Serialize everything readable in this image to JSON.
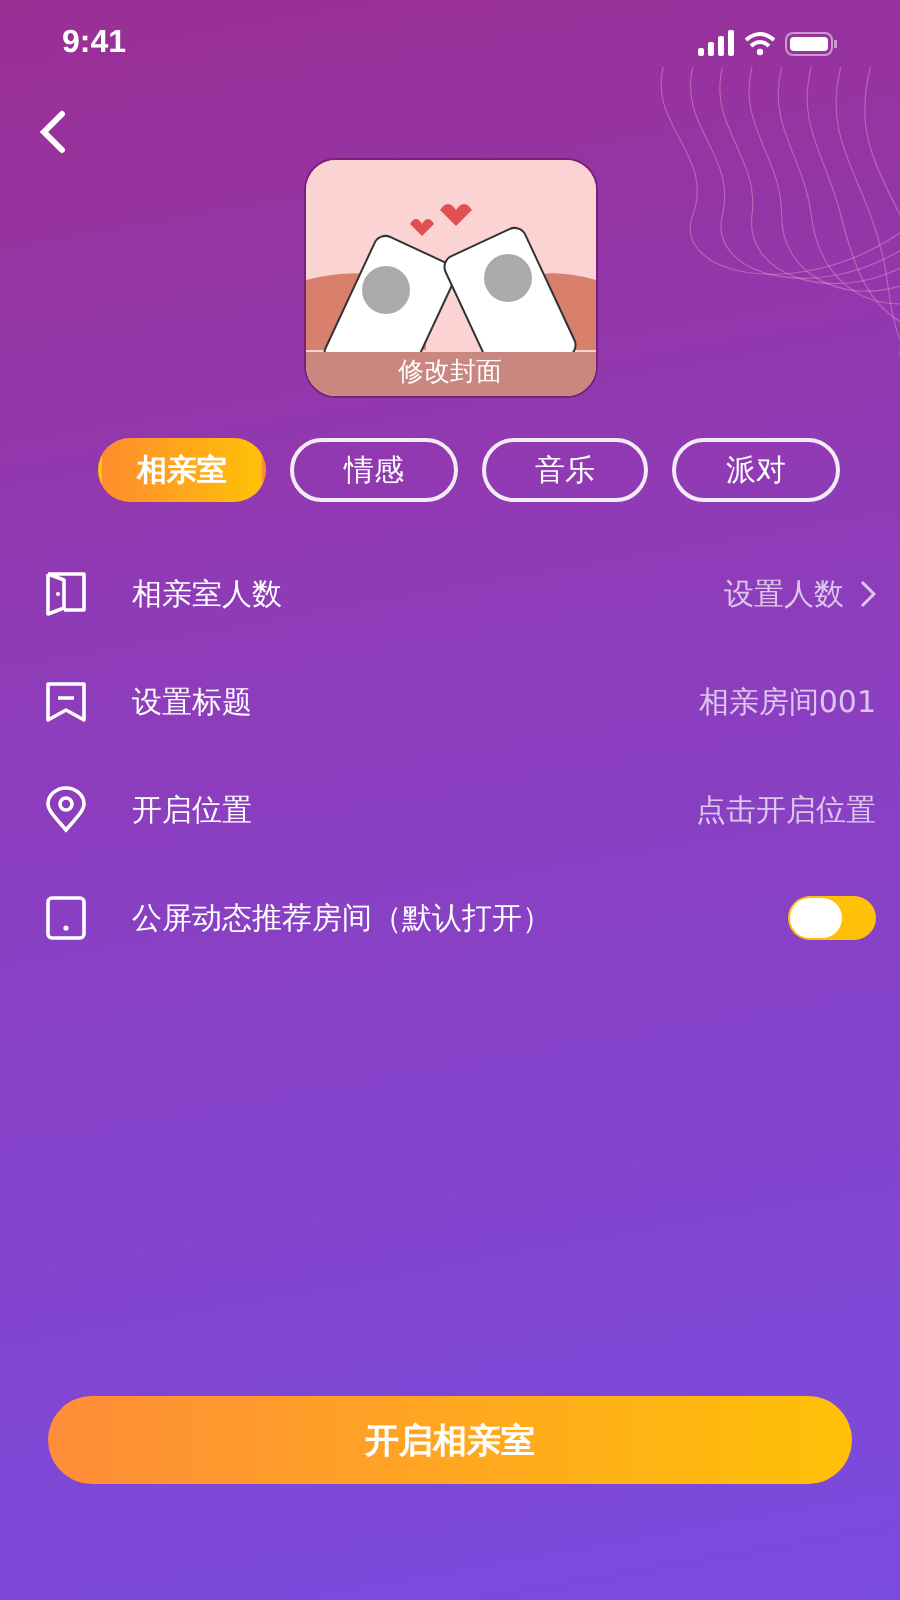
{
  "status_bar": {
    "time": "9:41"
  },
  "cover": {
    "caption": "修改封面"
  },
  "tags": [
    {
      "label": "相亲室",
      "selected": true
    },
    {
      "label": "情感",
      "selected": false
    },
    {
      "label": "音乐",
      "selected": false
    },
    {
      "label": "派对",
      "selected": false
    }
  ],
  "settings": [
    {
      "kind": "select",
      "label": "相亲室人数",
      "value": "设置人数"
    },
    {
      "kind": "text",
      "label": "设置标题",
      "value": "相亲房间001"
    },
    {
      "kind": "text",
      "label": "开启位置",
      "value": "点击开启位置"
    },
    {
      "kind": "toggle",
      "label": "公屏动态推荐房间（默认打开）",
      "on": true
    }
  ],
  "primary_button": "开启相亲室"
}
